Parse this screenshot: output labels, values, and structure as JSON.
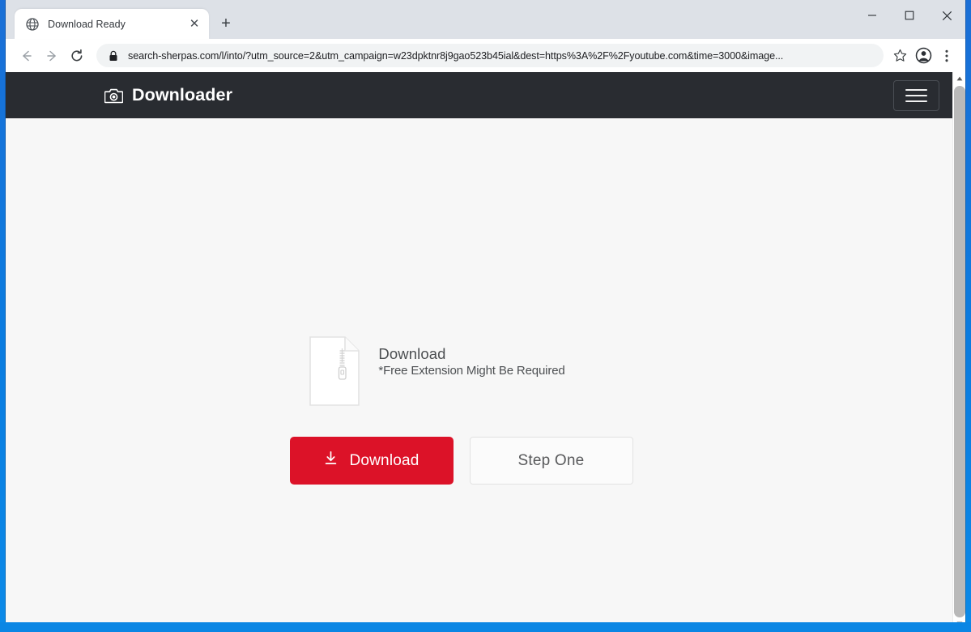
{
  "browser": {
    "tab": {
      "title": "Download Ready",
      "favicon_icon": "globe-icon",
      "close_icon": "✕"
    },
    "new_tab_icon": "+",
    "window_controls": {
      "minimize_icon": "minimize-icon",
      "maximize_icon": "maximize-icon",
      "close_icon": "close-icon"
    },
    "toolbar": {
      "back_icon": "back-arrow-icon",
      "forward_icon": "forward-arrow-icon",
      "reload_icon": "reload-icon",
      "lock_icon": "padlock-icon",
      "url": "search-sherpas.com/l/into/?utm_source=2&utm_campaign=w23dpktnr8j9gao523b45ial&dest=https%3A%2F%2Fyoutube.com&time=3000&image...",
      "bookmark_icon": "star-icon",
      "profile_icon": "account-avatar-icon",
      "menu_icon": "three-dot-menu-icon"
    }
  },
  "page": {
    "header": {
      "logo_icon": "camera-icon",
      "brand": "Downloader",
      "menu_toggle_icon": "hamburger-icon"
    },
    "content": {
      "file_icon": "zip-file-icon",
      "heading": "Download",
      "subtext": "*Free Extension Might Be Required",
      "primary_button": {
        "label": "Download",
        "icon": "download-arrow-icon"
      },
      "secondary_button": {
        "label": "Step One"
      }
    },
    "scrollbar": {
      "up_arrow_icon": "▲",
      "down_arrow_icon": "▼"
    }
  },
  "colors": {
    "header_bg": "#292C31",
    "page_bg": "#F7F7F7",
    "accent_red": "#DC1228",
    "desktop_blue": "#0B86E4"
  }
}
